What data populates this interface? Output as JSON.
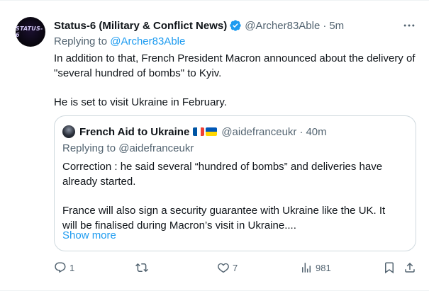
{
  "tweet": {
    "avatar_text": "STATUS-6",
    "name": "Status-6 (Military & Conflict News)",
    "handle": "@Archer83Able",
    "separator": "·",
    "time": "5m",
    "replying_prefix": "Replying to",
    "replying_handle": "@Archer83Able",
    "text_p1": "In addition to that, French President Macron announced about the delivery of \"several hundred of bombs\" to Kyiv.",
    "text_p2": "He is set to visit Ukraine in February."
  },
  "quote": {
    "name": "French Aid to Ukraine",
    "handle": "@aidefranceukr",
    "separator": "·",
    "time": "40m",
    "replying": "Replying to @aidefranceukr",
    "text_p1": "Correction : he said several “hundred of bombs” and deliveries have already started.",
    "text_p2": "France will also sign a security guarantee with Ukraine like the UK. It will be finalised during Macron’s visit in Ukraine....",
    "show_more": "Show more"
  },
  "actions": {
    "replies": "1",
    "reposts": "",
    "likes": "7",
    "views": "981"
  },
  "colors": {
    "link": "#1d9bf0",
    "secondary_text": "#536471",
    "border": "#cfd9de",
    "verified": "#1d9bf0"
  },
  "icons": [
    "verified-badge-icon",
    "more-options-icon",
    "reply-icon",
    "repost-icon",
    "like-icon",
    "views-icon",
    "bookmark-icon",
    "share-icon",
    "france-flag-icon",
    "ukraine-flag-icon"
  ]
}
